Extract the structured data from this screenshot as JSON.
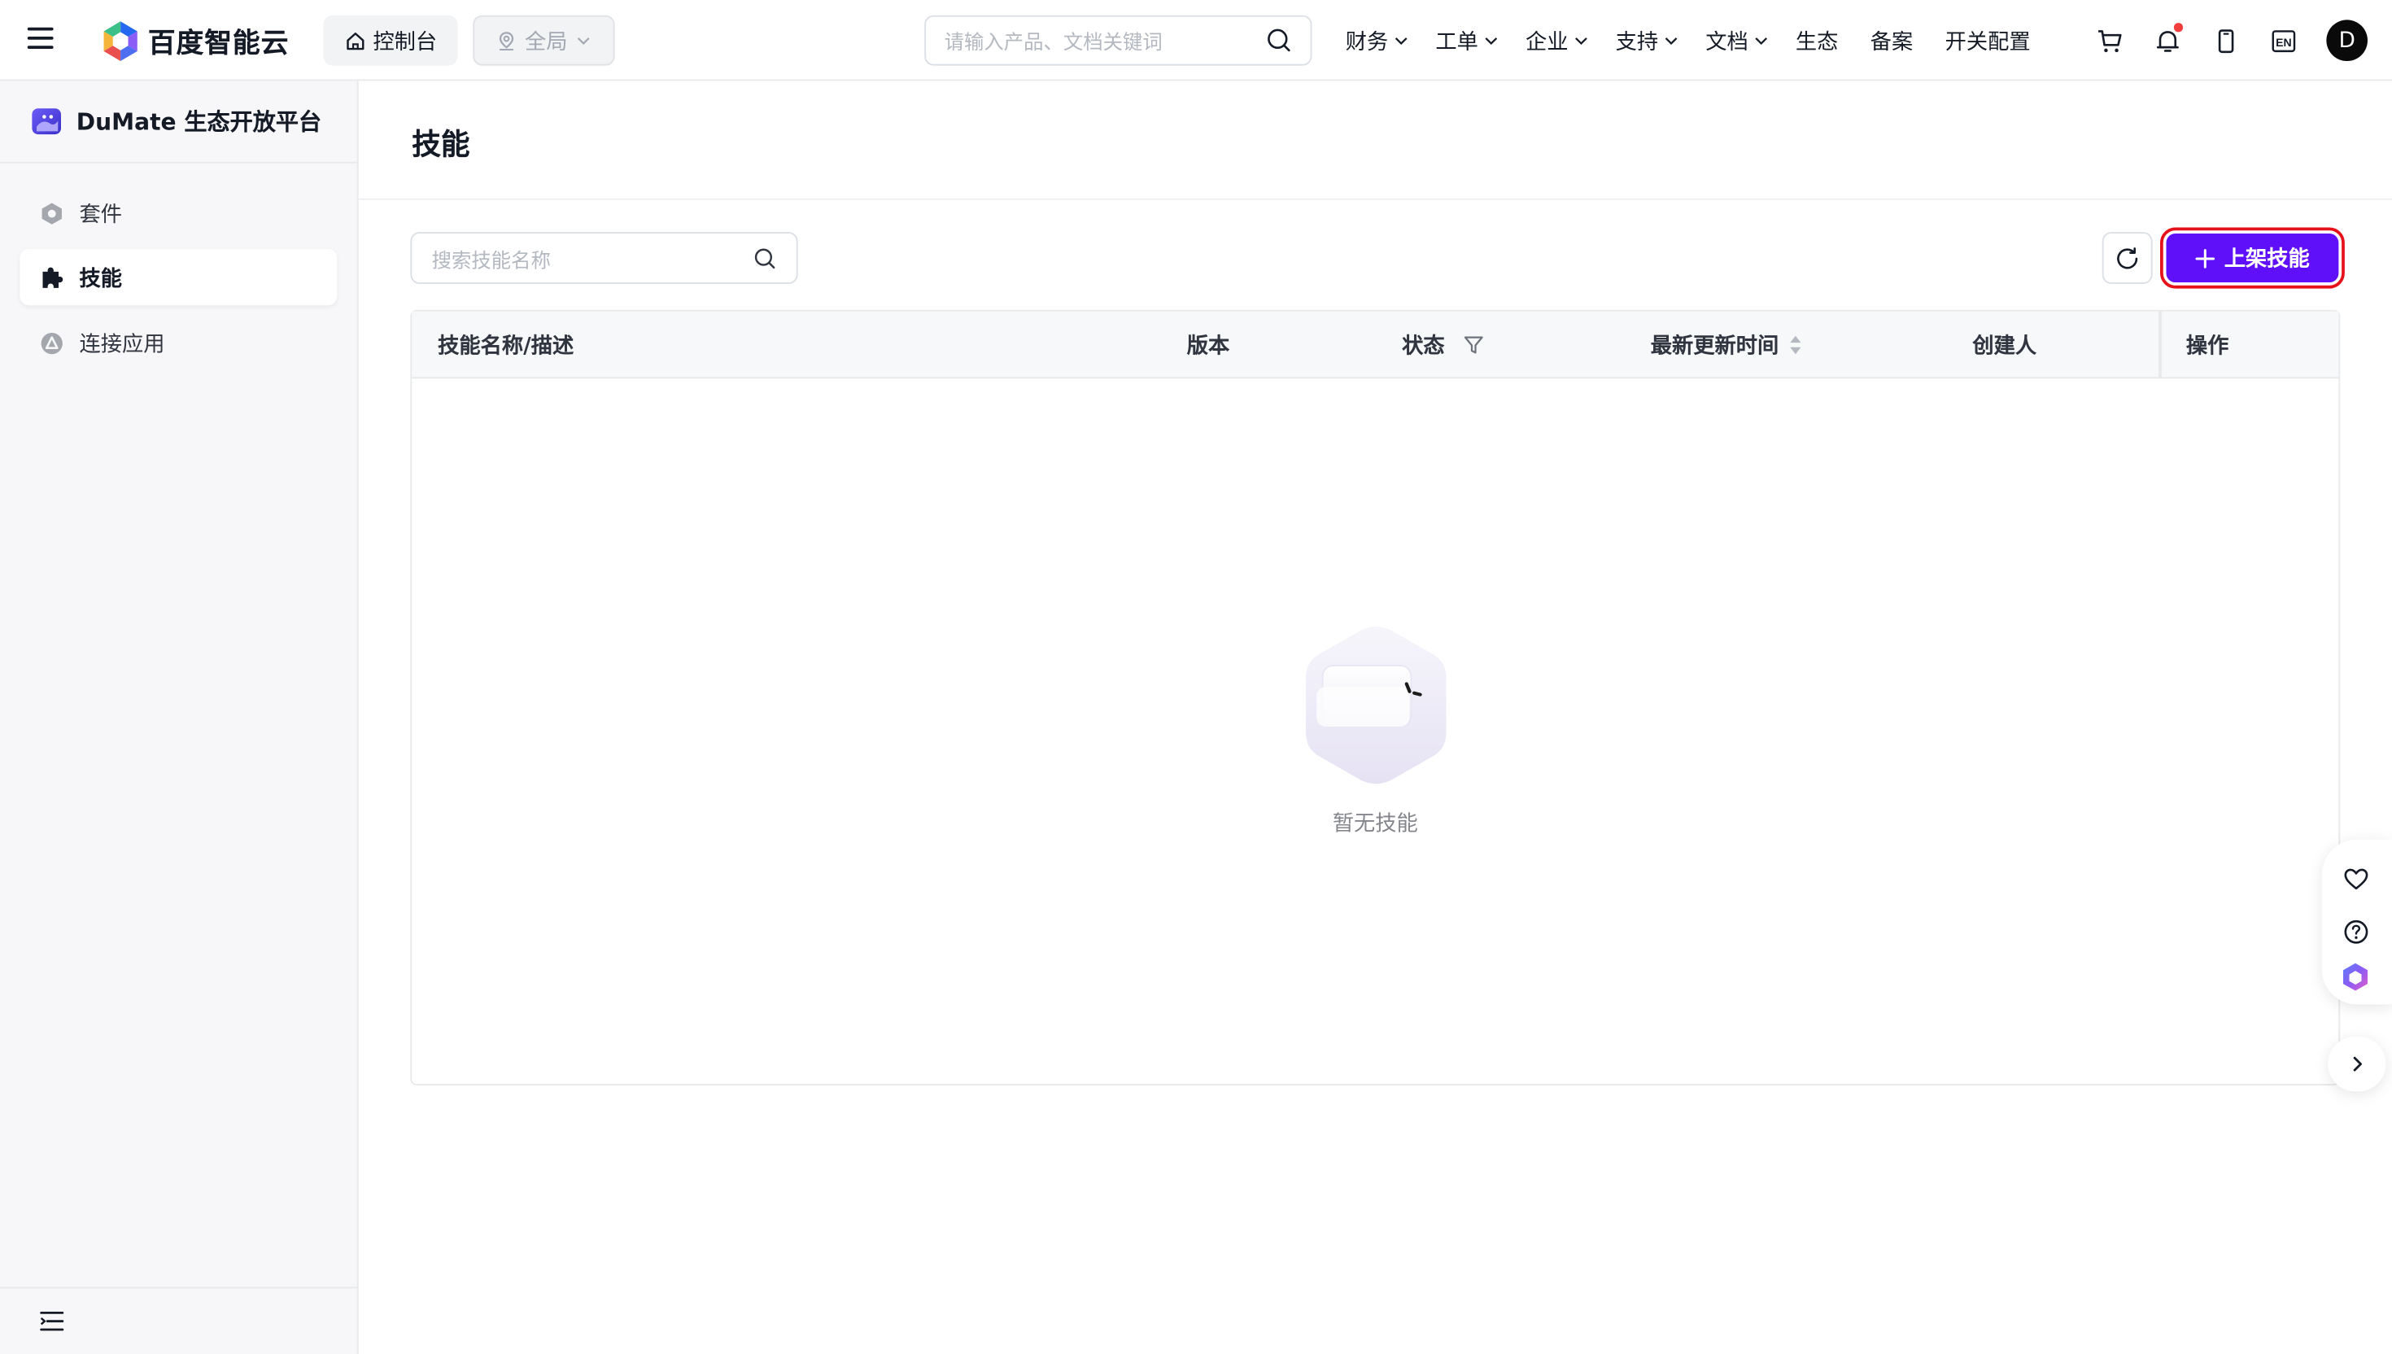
{
  "topbar": {
    "brand": "百度智能云",
    "console_label": "控制台",
    "region_label": "全局",
    "search_placeholder": "请输入产品、文档关键词",
    "nav": [
      {
        "label": "财务",
        "dropdown": true
      },
      {
        "label": "工单",
        "dropdown": true
      },
      {
        "label": "企业",
        "dropdown": true
      },
      {
        "label": "支持",
        "dropdown": true
      },
      {
        "label": "文档",
        "dropdown": true
      },
      {
        "label": "生态",
        "dropdown": false
      },
      {
        "label": "备案",
        "dropdown": false
      },
      {
        "label": "开关配置",
        "dropdown": false
      }
    ],
    "icons": [
      "cart-icon",
      "bell-icon",
      "mobile-icon",
      "language-en-icon"
    ],
    "lang_label": "EN",
    "avatar_letter": "D"
  },
  "sidebar": {
    "title": "DuMate 生态开放平台",
    "items": [
      {
        "label": "套件",
        "icon": "suite-icon",
        "active": false
      },
      {
        "label": "技能",
        "icon": "puzzle-icon",
        "active": true
      },
      {
        "label": "连接应用",
        "icon": "app-connect-icon",
        "active": false
      }
    ]
  },
  "main": {
    "title": "技能",
    "search_placeholder": "搜索技能名称",
    "add_button_label": "上架技能",
    "table": {
      "columns": [
        {
          "label": "技能名称/描述",
          "icon": ""
        },
        {
          "label": "版本",
          "icon": ""
        },
        {
          "label": "状态",
          "icon": "filter-icon"
        },
        {
          "label": "最新更新时间",
          "icon": "sort-icon"
        },
        {
          "label": "创建人",
          "icon": ""
        },
        {
          "label": "操作",
          "icon": ""
        }
      ],
      "rows": [],
      "empty_text": "暂无技能"
    }
  },
  "colors": {
    "primary": "#5f10f9",
    "highlight_border": "#e6121b",
    "notification_dot": "#f33e3e",
    "sidebar_bg": "#f7f7f9"
  }
}
